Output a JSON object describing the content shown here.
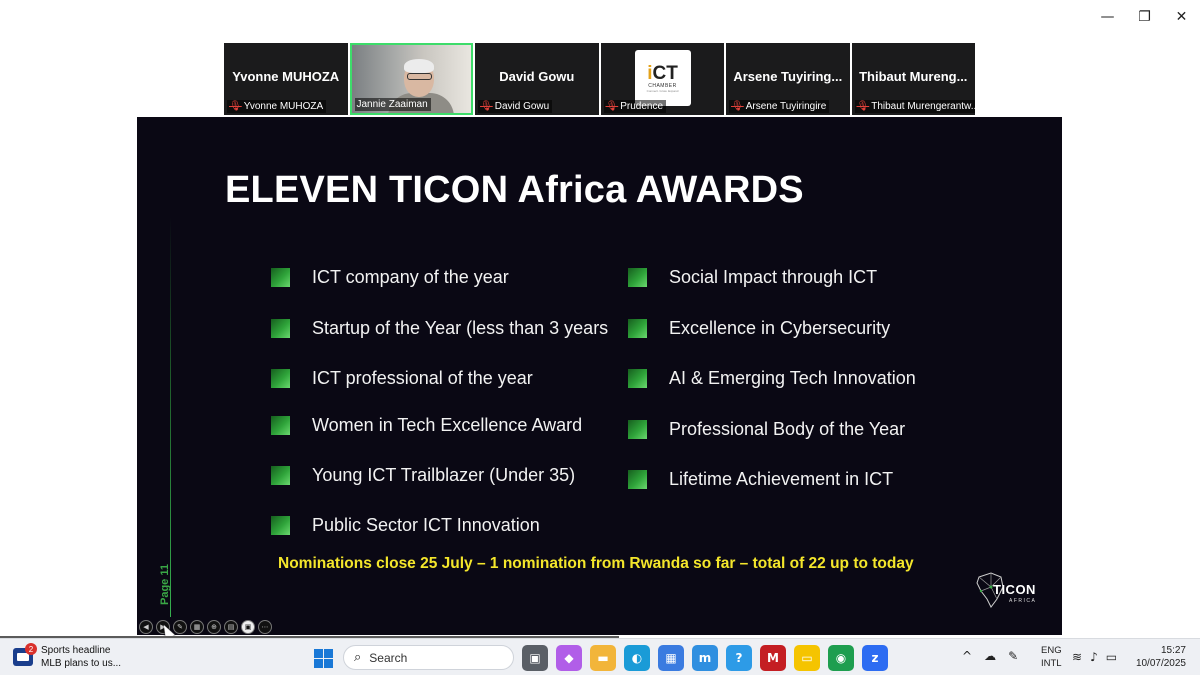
{
  "window": {
    "controls": [
      {
        "name": "minimize-button",
        "glyph": "—"
      },
      {
        "name": "restore-button",
        "glyph": "❐"
      },
      {
        "name": "close-button",
        "glyph": "✕"
      }
    ]
  },
  "participants": [
    {
      "display": "Yvonne MUHOZA",
      "label": "Yvonne MUHOZA",
      "muted": true,
      "type": "name"
    },
    {
      "display": "",
      "label": "Jannie Zaaiman",
      "muted": false,
      "type": "video"
    },
    {
      "display": "David Gowu",
      "label": "David Gowu",
      "muted": true,
      "type": "name"
    },
    {
      "display": "",
      "label": "Prudence",
      "muted": true,
      "type": "logo"
    },
    {
      "display": "Arsene Tuyiring...",
      "label": "Arsene Tuyiringire",
      "muted": true,
      "type": "name"
    },
    {
      "display": "Thibaut Mureng...",
      "label": "Thibaut Murengerantw...",
      "muted": true,
      "type": "name"
    }
  ],
  "logo_card": {
    "brand_prefix": "i",
    "brand_rest": "CT",
    "sub": "CHAMBER",
    "tag": "Connect. Grow. Expand"
  },
  "slide": {
    "title": "ELEVEN TICON Africa AWARDS",
    "awards_left": [
      "ICT company of the year",
      "Startup of the Year (less than 3 years",
      "ICT professional of the year",
      "Women in Tech Excellence Award",
      "Young ICT Trailblazer (Under 35)",
      "Public Sector ICT Innovation"
    ],
    "awards_right": [
      "Social Impact through ICT",
      "Excellence in Cybersecurity",
      "AI & Emerging Tech Innovation",
      "Professional Body of the Year",
      "Lifetime Achievement in ICT"
    ],
    "nominations": "Nominations close 25 July – 1 nomination from Rwanda so far – total of 22 up to today",
    "page_label": "Page 11",
    "logo_text": "TICON",
    "logo_sub": "AFRICA",
    "bullet_color": "#2fa43a",
    "highlight_color": "#f4e62b"
  },
  "slide_toolbar": [
    {
      "name": "prev-slide-button",
      "glyph": "◀"
    },
    {
      "name": "next-slide-button",
      "glyph": "▶"
    },
    {
      "name": "pen-tool-button",
      "glyph": "✎"
    },
    {
      "name": "slides-grid-button",
      "glyph": "▦"
    },
    {
      "name": "zoom-button",
      "glyph": "⊕"
    },
    {
      "name": "subtitles-button",
      "glyph": "▤"
    },
    {
      "name": "camera-button",
      "glyph": "▣"
    },
    {
      "name": "more-options-button",
      "glyph": "⋯"
    }
  ],
  "taskbar": {
    "news_badge": "2",
    "news_title": "Sports headline",
    "news_text": "MLB plans to us...",
    "search_placeholder": "Search",
    "search_glyph": "⌕",
    "apps": [
      {
        "name": "task-view-icon",
        "glyph": "▣",
        "color": "#5a5f66"
      },
      {
        "name": "copilot-icon",
        "glyph": "◆",
        "color": "#b15ee8"
      },
      {
        "name": "file-explorer-icon",
        "glyph": "▬",
        "color": "#f2b53a"
      },
      {
        "name": "edge-icon",
        "glyph": "◐",
        "color": "#1a9bd7"
      },
      {
        "name": "microsoft-store-icon",
        "glyph": "▦",
        "color": "#3a7be0"
      },
      {
        "name": "mvp-app-icon",
        "glyph": "m",
        "color": "#2f8fe0"
      },
      {
        "name": "help-icon",
        "glyph": "?",
        "color": "#2d9be7"
      },
      {
        "name": "mcafee-icon",
        "glyph": "M",
        "color": "#c41e23"
      },
      {
        "name": "sticky-notes-icon",
        "glyph": "▭",
        "color": "#f5c400"
      },
      {
        "name": "chrome-icon",
        "glyph": "◉",
        "color": "#1e9e4f"
      },
      {
        "name": "zoom-app-icon",
        "glyph": "z",
        "color": "#2d6cf2"
      }
    ],
    "tray": [
      {
        "name": "show-hidden-icons-chevron-icon",
        "glyph": "^"
      },
      {
        "name": "cloud-sync-icon",
        "glyph": "☁"
      },
      {
        "name": "pen-input-icon",
        "glyph": "✎"
      }
    ],
    "lang_1": "ENG",
    "lang_2": "INTL",
    "sys": [
      {
        "name": "wifi-icon",
        "glyph": "≋"
      },
      {
        "name": "volume-icon",
        "glyph": "♪"
      },
      {
        "name": "battery-icon",
        "glyph": "▭"
      }
    ],
    "time": "15:27",
    "date": "10/07/2025"
  }
}
